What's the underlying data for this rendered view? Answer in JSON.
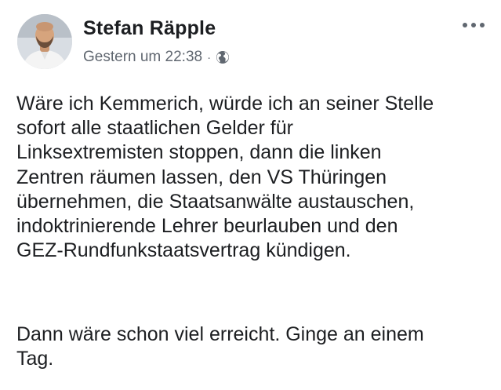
{
  "post": {
    "author": "Stefan Räpple",
    "timestamp": "Gestern um 22:38",
    "separator": "·",
    "audience_icon": "globe-icon",
    "more_icon": "more-options-icon",
    "paragraphs": [
      "Wäre ich Kemmerich, würde ich an seiner Stelle\nsofort alle staatlichen Gelder für\nLinksextremisten stoppen, dann die linken\nZentren räumen lassen, den VS Thüringen\nübernehmen, die Staatsanwälte austauschen,\nindoktrinierende Lehrer beurlauben und den\nGEZ-Rundfunkstaatsvertrag kündigen.",
      "Dann wäre schon viel erreicht. Ginge an einem\nTag."
    ]
  },
  "colors": {
    "text": "#1c1e21",
    "meta_text": "#606770",
    "background": "#ffffff"
  }
}
